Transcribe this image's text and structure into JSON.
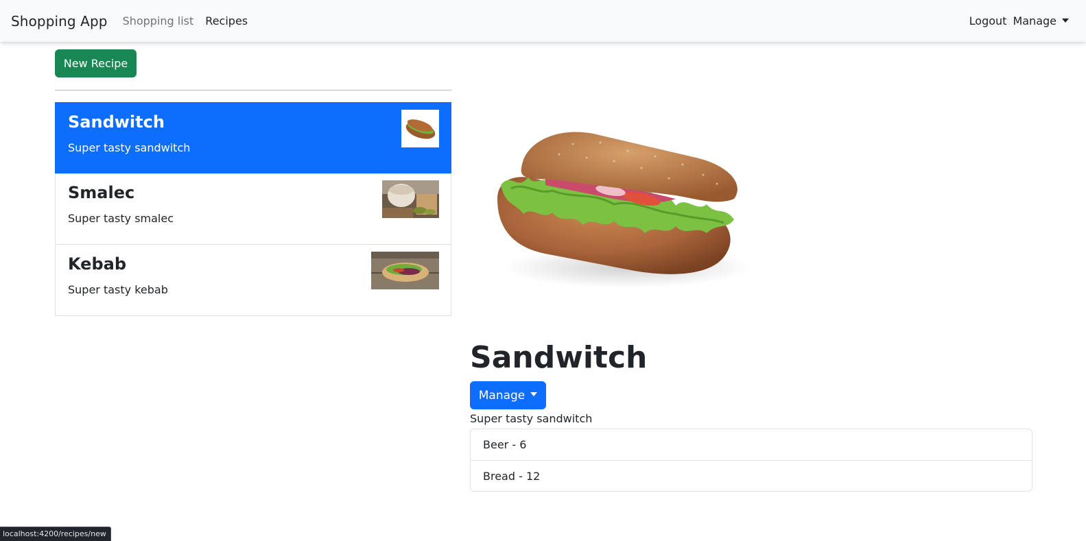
{
  "navbar": {
    "brand": "Shopping App",
    "links": [
      {
        "label": "Shopping list"
      },
      {
        "label": "Recipes"
      }
    ],
    "logout_label": "Logout",
    "manage_label": "Manage"
  },
  "new_recipe_label": "New Recipe",
  "recipes": [
    {
      "name": "Sandwitch",
      "description": "Super tasty sandwitch",
      "image": "sandwich-thumb"
    },
    {
      "name": "Smalec",
      "description": "Super tasty smalec",
      "image": "smalec-thumb"
    },
    {
      "name": "Kebab",
      "description": "Super tasty kebab",
      "image": "kebab-thumb"
    }
  ],
  "detail": {
    "title": "Sandwitch",
    "manage_label": "Manage",
    "description": "Super tasty sandwitch",
    "ingredients": [
      {
        "text": "Beer - 6"
      },
      {
        "text": "Bread - 12"
      }
    ]
  },
  "status_url": "localhost:4200/recipes/new",
  "colors": {
    "primary": "#0d6efd",
    "success": "#198754",
    "navbar_bg": "#f8f9fa"
  }
}
